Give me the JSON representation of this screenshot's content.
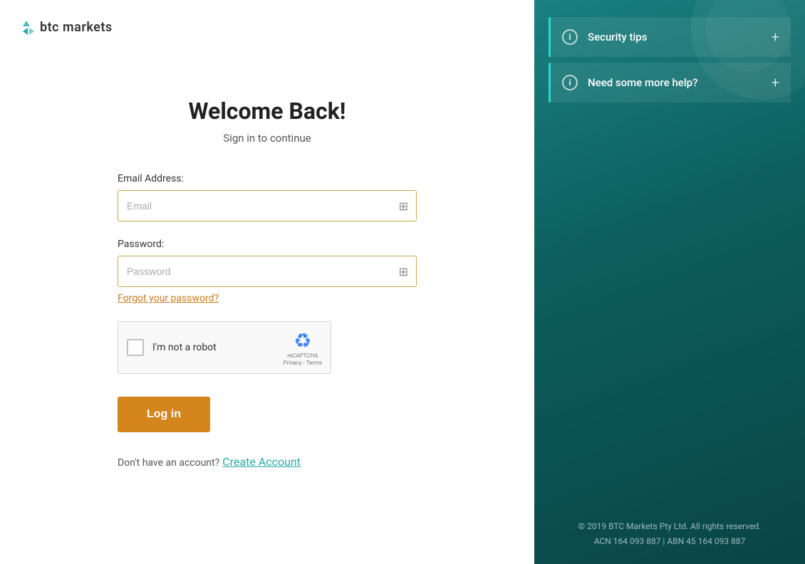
{
  "logo": {
    "text": "btc markets",
    "icon": "◈"
  },
  "left": {
    "title": "Welcome Back!",
    "subtitle": "Sign in to continue",
    "email_label": "Email Address:",
    "email_placeholder": "Email",
    "password_label": "Password:",
    "password_placeholder": "Password",
    "forgot_password": "Forgot your password?",
    "recaptcha_label": "I'm not a robot",
    "recaptcha_brand": "reCAPTCHA",
    "recaptcha_links": "Privacy - Terms",
    "login_button": "Log in",
    "no_account_text": "Don't have an account?",
    "create_account_link": "Create Account"
  },
  "right": {
    "accordion": [
      {
        "label": "Security tips",
        "icon": "i"
      },
      {
        "label": "Need some more help?",
        "icon": "i"
      }
    ],
    "footer": {
      "line1": "© 2019 BTC Markets Pty Ltd. All rights reserved.",
      "line2": "ACN 164 093 887 | ABN 45 164 093 887"
    }
  },
  "colors": {
    "accent_teal": "#2aa8a8",
    "accent_orange": "#d4851c",
    "right_panel_bg": "#0d6b6b"
  }
}
